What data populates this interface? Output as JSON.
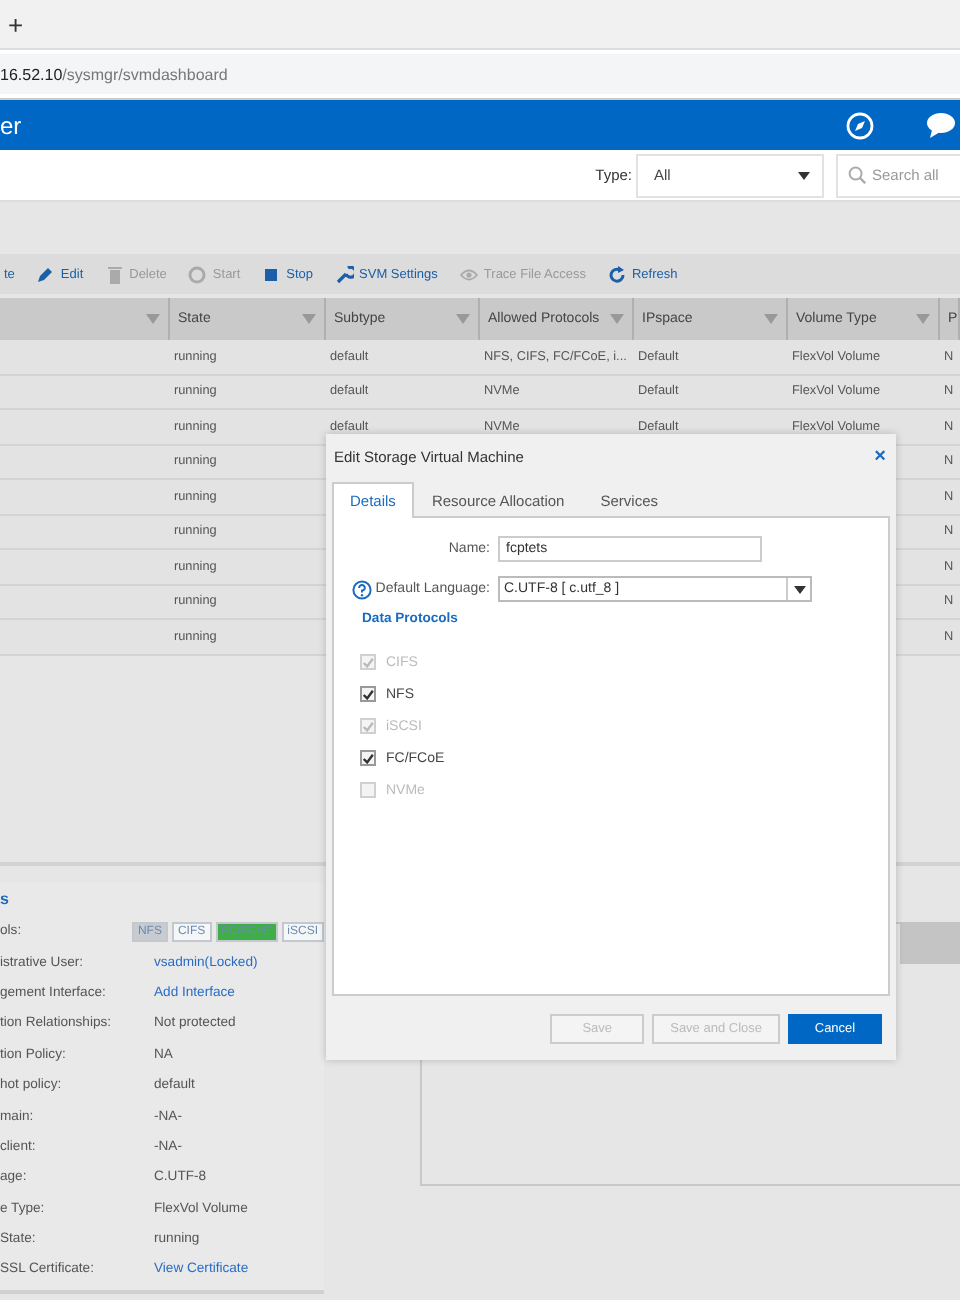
{
  "browser": {
    "new_tab": "+",
    "address_host": "16.52.10",
    "address_path": "/sysmgr/svmdashboard"
  },
  "header": {
    "title": "er"
  },
  "filter": {
    "type_label": "Type:",
    "type_value": "All",
    "search_placeholder": "Search all"
  },
  "actions": [
    {
      "label": "te",
      "disabled": false
    },
    {
      "label": "Edit",
      "disabled": false
    },
    {
      "label": "Delete",
      "disabled": true
    },
    {
      "label": "Start",
      "disabled": true
    },
    {
      "label": "Stop",
      "disabled": false
    },
    {
      "label": "SVM Settings",
      "disabled": false
    },
    {
      "label": "Trace File Access",
      "disabled": true
    },
    {
      "label": "Refresh",
      "disabled": false
    }
  ],
  "table": {
    "columns": [
      "",
      "State",
      "Subtype",
      "Allowed Protocols",
      "IPspace",
      "Volume Type",
      "P"
    ],
    "rows": [
      {
        "state": "running",
        "subtype": "default",
        "allowed_protocols": "NFS, CIFS, FC/FCoE, i...",
        "ipspace": "Default",
        "volume_type": "FlexVol Volume",
        "column_7": "N"
      },
      {
        "state": "running",
        "subtype": "default",
        "allowed_protocols": "NVMe",
        "ipspace": "Default",
        "volume_type": "FlexVol Volume",
        "column_7": "N"
      },
      {
        "state": "running",
        "subtype": "default",
        "allowed_protocols": "NVMe",
        "ipspace": "Default",
        "volume_type": "FlexVol Volume",
        "column_7": "N"
      },
      {
        "state": "running",
        "column_7": "N"
      },
      {
        "state": "running",
        "column_7": "N"
      },
      {
        "state": "running",
        "column_7": "N"
      },
      {
        "state": "running",
        "column_7": "N"
      },
      {
        "state": "running",
        "column_7": "N"
      },
      {
        "state": "running",
        "column_7": "N"
      }
    ]
  },
  "details": {
    "title": "s",
    "rows": [
      {
        "label": "ols:",
        "kind": "tags",
        "tags": [
          {
            "text": "NFS",
            "color": "#c8ccd0"
          },
          {
            "text": "CIFS",
            "color": "#f4f6f8"
          },
          {
            "text": "FC/FCoE",
            "color": "#3fae49"
          },
          {
            "text": "iSCSI",
            "color": "#f4f6f8"
          }
        ]
      },
      {
        "label": "istrative User:",
        "kind": "link",
        "value": "vsadmin(Locked)"
      },
      {
        "label": "gement Interface:",
        "kind": "link",
        "value": "Add Interface"
      },
      {
        "label": "tion Relationships:",
        "kind": "text",
        "value": "Not protected"
      },
      {
        "label": "tion Policy:",
        "kind": "text",
        "value": "NA"
      },
      {
        "label": "hot policy:",
        "kind": "text",
        "value": "default"
      },
      {
        "label": "main:",
        "kind": "text",
        "value": "-NA-"
      },
      {
        "label": "client:",
        "kind": "text",
        "value": "-NA-"
      },
      {
        "label": "age:",
        "kind": "text",
        "value": "C.UTF-8"
      },
      {
        "label": "e Type:",
        "kind": "text",
        "value": "FlexVol Volume"
      },
      {
        "label": "State:",
        "kind": "text",
        "value": "running"
      },
      {
        "label": "SSL Certificate:",
        "kind": "link",
        "value": "View Certificate"
      }
    ]
  },
  "dialog": {
    "title": "Edit Storage Virtual Machine",
    "close": "×",
    "tabs": [
      {
        "label": "Details",
        "selected": true
      },
      {
        "label": "Resource Allocation",
        "selected": false
      },
      {
        "label": "Services",
        "selected": false
      }
    ],
    "name_label": "Name:",
    "name_value": "fcptets",
    "language_label": "Default Language:",
    "language_value": "C.UTF-8 [ c.utf_8 ]",
    "protocols_heading": "Data Protocols",
    "protocols": [
      {
        "label": "CIFS",
        "checked": true,
        "disabled": true
      },
      {
        "label": "NFS",
        "checked": true,
        "disabled": false
      },
      {
        "label": "iSCSI",
        "checked": true,
        "disabled": true
      },
      {
        "label": "FC/FCoE",
        "checked": true,
        "disabled": false
      },
      {
        "label": "NVMe",
        "checked": false,
        "disabled": true
      }
    ],
    "buttons": [
      {
        "label": "Save",
        "kind": "secondary",
        "disabled": true
      },
      {
        "label": "Save and Close",
        "kind": "secondary",
        "disabled": true
      },
      {
        "label": "Cancel",
        "kind": "primary",
        "disabled": false
      }
    ]
  }
}
